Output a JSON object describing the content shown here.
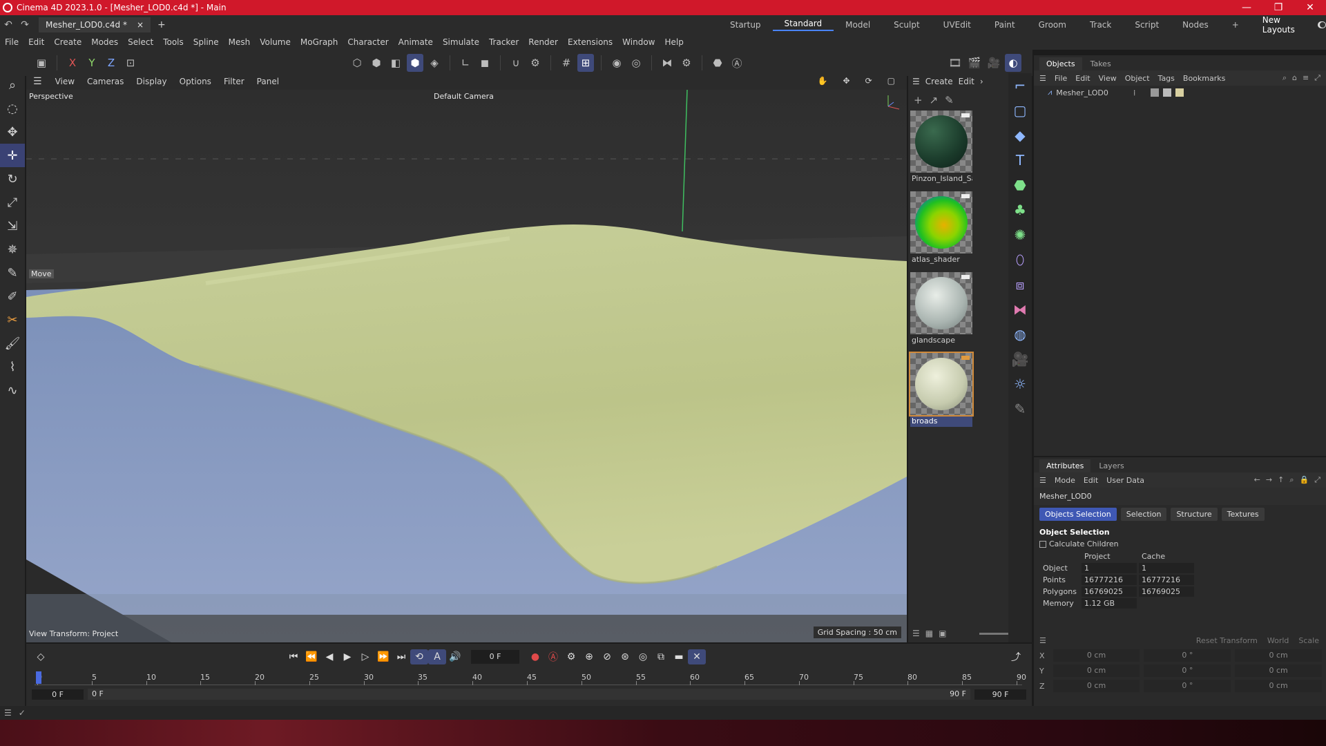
{
  "titlebar": {
    "title": "Cinema 4D 2023.1.0 - [Mesher_LOD0.c4d *] - Main",
    "min": "—",
    "max": "❐",
    "close": "✕"
  },
  "doc": {
    "tab": "Mesher_LOD0.c4d *",
    "close": "×",
    "add": "+"
  },
  "layouts": {
    "items": [
      "Startup",
      "Standard",
      "Model",
      "Sculpt",
      "UVEdit",
      "Paint",
      "Groom",
      "Track",
      "Script",
      "Nodes"
    ],
    "active": "Standard",
    "add": "+",
    "new_layouts": "New Layouts"
  },
  "menubar": [
    "File",
    "Edit",
    "Create",
    "Modes",
    "Select",
    "Tools",
    "Spline",
    "Mesh",
    "Volume",
    "MoGraph",
    "Character",
    "Animate",
    "Simulate",
    "Tracker",
    "Render",
    "Extensions",
    "Window",
    "Help"
  ],
  "toolbar": {
    "x": "X",
    "y": "Y",
    "z": "Z"
  },
  "viewport": {
    "menu": [
      "View",
      "Cameras",
      "Display",
      "Options",
      "Filter",
      "Panel"
    ],
    "label": "Perspective",
    "camera": "Default Camera",
    "tool_label": "Move",
    "view_transform": "View Transform: Project",
    "grid_spacing": "Grid Spacing : 50 cm"
  },
  "materials": {
    "menu": [
      "Create",
      "Edit"
    ],
    "items": [
      {
        "name": "Pinzon_Island_Sat"
      },
      {
        "name": "atlas_shader"
      },
      {
        "name": "glandscape"
      },
      {
        "name": "broads"
      }
    ],
    "selected": "broads"
  },
  "objects": {
    "tabs": [
      "Objects",
      "Takes"
    ],
    "menu": [
      "File",
      "Edit",
      "View",
      "Object",
      "Tags",
      "Bookmarks"
    ],
    "rows": [
      {
        "name": "Mesher_LOD0"
      }
    ]
  },
  "attributes": {
    "tabs": [
      "Attributes",
      "Layers"
    ],
    "menu": [
      "Mode",
      "Edit",
      "User Data"
    ],
    "object_name": "Mesher_LOD0",
    "chips": [
      "Objects Selection",
      "Selection",
      "Structure",
      "Textures"
    ],
    "section": "Object Selection",
    "calc_children": "Calculate Children",
    "cols": [
      "Project",
      "Cache"
    ],
    "stats": [
      {
        "label": "Object",
        "project": "1",
        "cache": "1"
      },
      {
        "label": "Points",
        "project": "16777216",
        "cache": "16777216"
      },
      {
        "label": "Polygons",
        "project": "16769025",
        "cache": "16769025"
      },
      {
        "label": "Memory",
        "project": "1.12 GB",
        "cache": ""
      }
    ],
    "transform": {
      "reset": "Reset Transform",
      "space": "World",
      "mode": "Scale",
      "rows": [
        {
          "axis": "X",
          "pos": "0 cm",
          "rot": "0 °",
          "scale": "0 cm"
        },
        {
          "axis": "Y",
          "pos": "0 cm",
          "rot": "0 °",
          "scale": "0 cm"
        },
        {
          "axis": "Z",
          "pos": "0 cm",
          "rot": "0 °",
          "scale": "0 cm"
        }
      ]
    }
  },
  "timeline": {
    "current": "0 F",
    "ticks": [
      "0",
      "5",
      "10",
      "15",
      "20",
      "25",
      "30",
      "35",
      "40",
      "45",
      "50",
      "55",
      "60",
      "65",
      "70",
      "75",
      "80",
      "85",
      "90"
    ],
    "range_start": "0 F",
    "range_start2": "0 F",
    "range_end": "90 F",
    "range_end2": "90 F"
  },
  "colors": {
    "accent": "#4a84ff",
    "title_red": "#d0182a",
    "selection": "#3f58b4"
  }
}
